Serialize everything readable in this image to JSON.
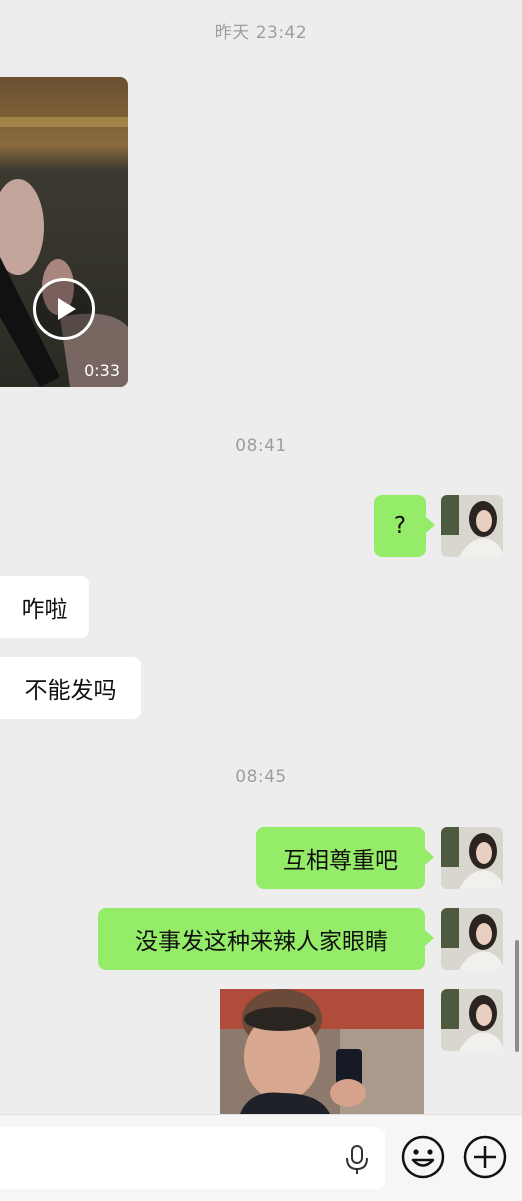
{
  "timestamps": [
    "昨天 23:42",
    "08:41",
    "08:45"
  ],
  "video_message": {
    "duration": "0:33",
    "icon": "play-icon"
  },
  "messages": [
    {
      "side": "out",
      "text": "?"
    },
    {
      "side": "in",
      "text": "咋啦"
    },
    {
      "side": "in",
      "text": "不能发吗"
    },
    {
      "side": "out",
      "text": "互相尊重吧"
    },
    {
      "side": "out",
      "text": "没事发这种来辣人家眼睛"
    }
  ],
  "input_bar": {
    "voice_icon": "microphone-icon",
    "emoji_icon": "smiley-icon",
    "more_icon": "plus-circle-icon"
  },
  "colors": {
    "background": "#ededed",
    "outgoing_bubble": "#95ec69",
    "incoming_bubble": "#ffffff",
    "timestamp_text": "#9e9e9e"
  }
}
